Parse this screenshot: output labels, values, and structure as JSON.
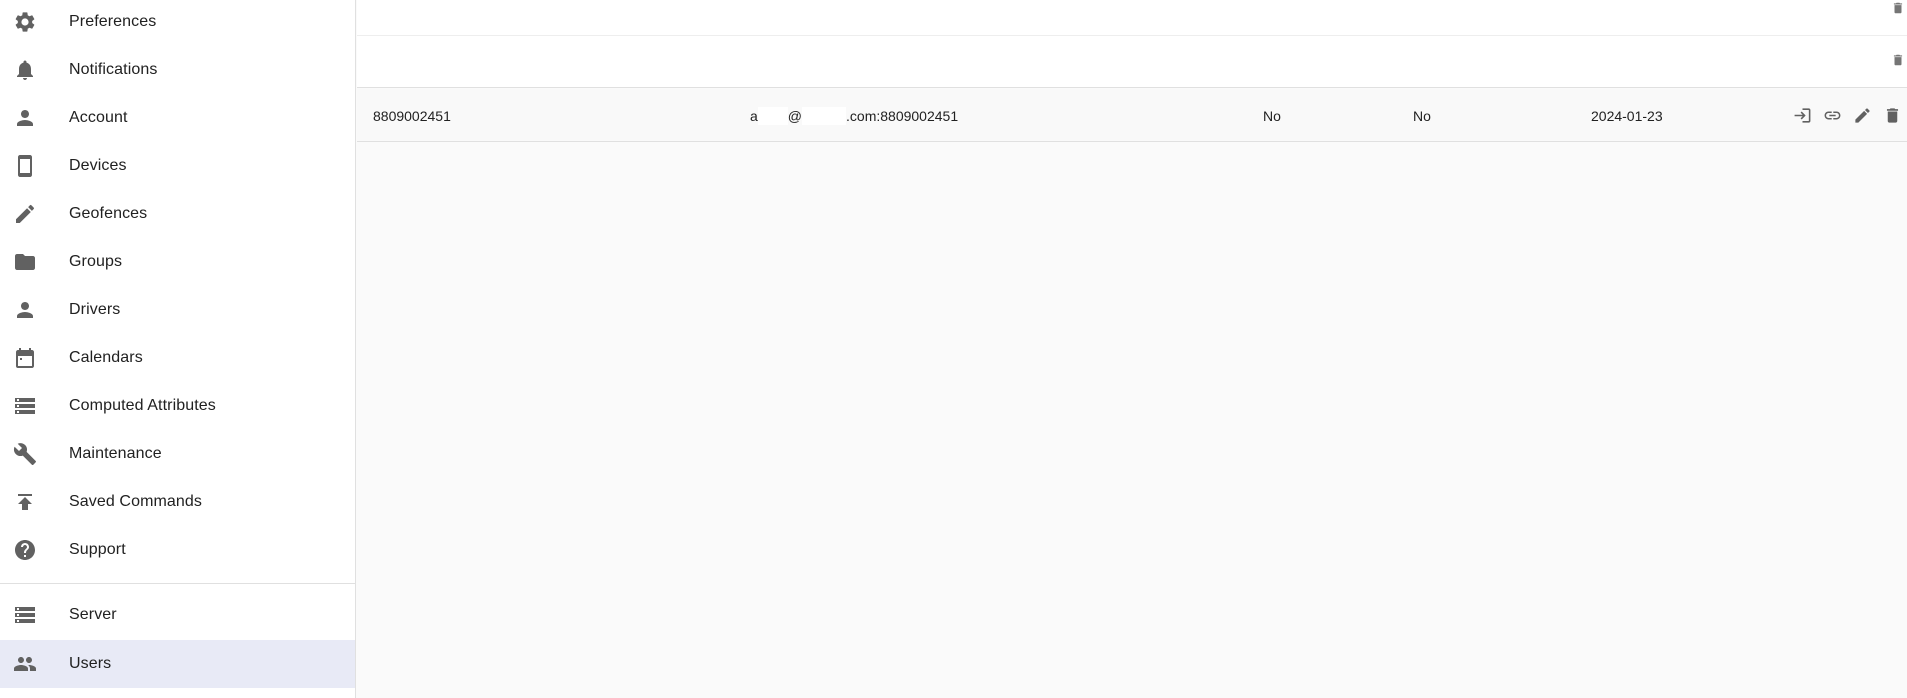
{
  "sidebar": {
    "items": [
      {
        "label": "Preferences",
        "icon": "gear-icon"
      },
      {
        "label": "Notifications",
        "icon": "bell-icon"
      },
      {
        "label": "Account",
        "icon": "person-icon"
      },
      {
        "label": "Devices",
        "icon": "smartphone-icon"
      },
      {
        "label": "Geofences",
        "icon": "pencil-icon"
      },
      {
        "label": "Groups",
        "icon": "folder-icon"
      },
      {
        "label": "Drivers",
        "icon": "person-icon"
      },
      {
        "label": "Calendars",
        "icon": "calendar-icon"
      },
      {
        "label": "Computed Attributes",
        "icon": "storage-icon"
      },
      {
        "label": "Maintenance",
        "icon": "wrench-icon"
      },
      {
        "label": "Saved Commands",
        "icon": "publish-icon"
      },
      {
        "label": "Support",
        "icon": "help-icon"
      }
    ],
    "admin_items": [
      {
        "label": "Server",
        "icon": "storage-icon"
      },
      {
        "label": "Users",
        "icon": "people-icon",
        "selected": true
      }
    ],
    "selected_color": "#e8eaf6"
  },
  "table": {
    "rows": [
      {
        "name": "8809002451",
        "email_prefix": "a",
        "email_at": "@",
        "email_suffix": ".com:8809002451",
        "administrator": "No",
        "disabled": "No",
        "expiration": "2024-01-23",
        "actions": [
          "login-icon",
          "link-icon",
          "edit-icon",
          "delete-icon"
        ]
      }
    ]
  },
  "colors": {
    "icon": "#616161",
    "divider": "#e0e0e0",
    "background": "#fafafa"
  }
}
